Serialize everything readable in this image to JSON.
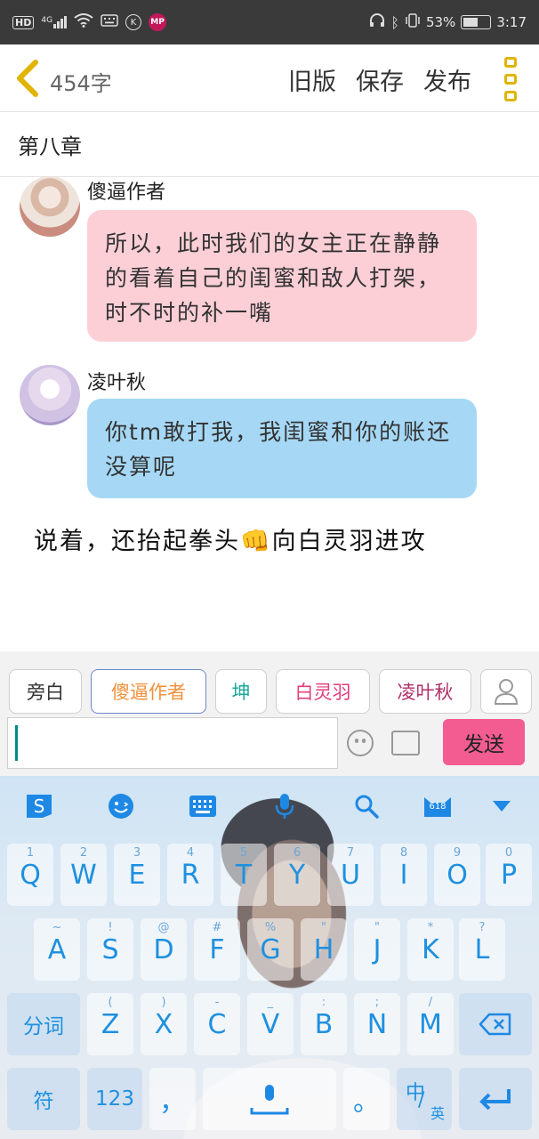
{
  "status_bar": {
    "left_icons": [
      "hd-icon",
      "signal-icon",
      "wifi-icon",
      "keyboard-icon",
      "k-app-icon",
      "mp-app-icon"
    ],
    "hd": "HD",
    "net": "4G",
    "k": "K",
    "mp": "MP",
    "battery": "53%",
    "time": "3:17"
  },
  "header": {
    "word_count": "454字",
    "old_version": "旧版",
    "save": "保存",
    "publish": "发布"
  },
  "chapter_title": "第八章",
  "messages": [
    {
      "speaker": "傻逼作者",
      "text": "所以，此时我们的女主正在静静的看着自己的闺蜜和敌人打架，时不时的补一嘴",
      "color": "#fccfd7"
    },
    {
      "speaker": "凌叶秋",
      "text": "你tm敢打我，我闺蜜和你的账还没算呢",
      "color": "#a6d8f6"
    }
  ],
  "narration": "说着，还抬起拳头👊向白灵羽进攻",
  "roles": [
    {
      "label": "旁白",
      "color": "#333333"
    },
    {
      "label": "傻逼作者",
      "color": "#f0913a"
    },
    {
      "label": "坤",
      "color": "#1aa89b"
    },
    {
      "label": "白灵羽",
      "color": "#e23b7a"
    },
    {
      "label": "凌叶秋",
      "color": "#b0306a"
    }
  ],
  "input": {
    "value": "",
    "send": "发送"
  },
  "keyboard": {
    "toolbar": [
      "sogou-logo-icon",
      "emoji-icon",
      "keyboard-icon",
      "microphone-icon",
      "search-icon",
      "skin-icon",
      "collapse-icon"
    ],
    "skin_badge": "618",
    "row1": [
      {
        "k": "Q",
        "s": "1"
      },
      {
        "k": "W",
        "s": "2"
      },
      {
        "k": "E",
        "s": "3"
      },
      {
        "k": "R",
        "s": "4"
      },
      {
        "k": "T",
        "s": "5"
      },
      {
        "k": "Y",
        "s": "6"
      },
      {
        "k": "U",
        "s": "7"
      },
      {
        "k": "I",
        "s": "8"
      },
      {
        "k": "O",
        "s": "9"
      },
      {
        "k": "P",
        "s": "0"
      }
    ],
    "row2": [
      {
        "k": "A",
        "s": "~"
      },
      {
        "k": "S",
        "s": "!"
      },
      {
        "k": "D",
        "s": "@"
      },
      {
        "k": "F",
        "s": "#"
      },
      {
        "k": "G",
        "s": "%"
      },
      {
        "k": "H",
        "s": "\""
      },
      {
        "k": "J",
        "s": "\""
      },
      {
        "k": "K",
        "s": "*"
      },
      {
        "k": "L",
        "s": "?"
      }
    ],
    "row3": [
      {
        "k": "Z",
        "s": "("
      },
      {
        "k": "X",
        "s": ")"
      },
      {
        "k": "C",
        "s": "-"
      },
      {
        "k": "V",
        "s": "_"
      },
      {
        "k": "B",
        "s": ":"
      },
      {
        "k": "N",
        "s": ";"
      },
      {
        "k": "M",
        "s": "/"
      }
    ],
    "fenci": "分词",
    "symbols": "符",
    "num": "123",
    "comma": "，",
    "period": "。",
    "lang_main": "中",
    "lang_sub": "英"
  }
}
